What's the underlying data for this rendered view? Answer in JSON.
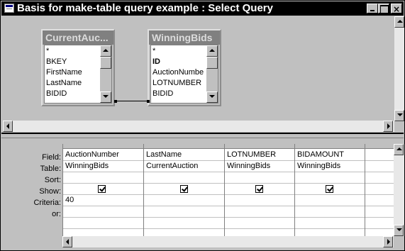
{
  "window": {
    "title": "Basis for make-table query example : Select Query"
  },
  "tables": [
    {
      "name": "CurrentAuc...",
      "fields": [
        "*",
        "BKEY",
        "FirstName",
        "LastName",
        "BIDID"
      ]
    },
    {
      "name": "WinningBids",
      "fields": [
        "*",
        "ID",
        "AuctionNumbe",
        "LOTNUMBER",
        "BIDID"
      ]
    }
  ],
  "grid": {
    "row_labels": [
      "Field:",
      "Table:",
      "Sort:",
      "Show:",
      "Criteria:",
      "or:"
    ],
    "columns": [
      {
        "field": "AuctionNumber",
        "table": "WinningBids",
        "sort": "",
        "show": true,
        "criteria": "40",
        "or": ""
      },
      {
        "field": "LastName",
        "table": "CurrentAuction",
        "sort": "",
        "show": true,
        "criteria": "",
        "or": ""
      },
      {
        "field": "LOTNUMBER",
        "table": "WinningBids",
        "sort": "",
        "show": true,
        "criteria": "",
        "or": ""
      },
      {
        "field": "BIDAMOUNT",
        "table": "WinningBids",
        "sort": "",
        "show": true,
        "criteria": "",
        "or": ""
      },
      {
        "field": "",
        "table": "",
        "sort": "",
        "show": false,
        "criteria": "",
        "or": ""
      }
    ]
  },
  "colors": {
    "titlebar_bg": "#000000",
    "face": "#c0c0c0",
    "table_title_bg": "#808080"
  }
}
